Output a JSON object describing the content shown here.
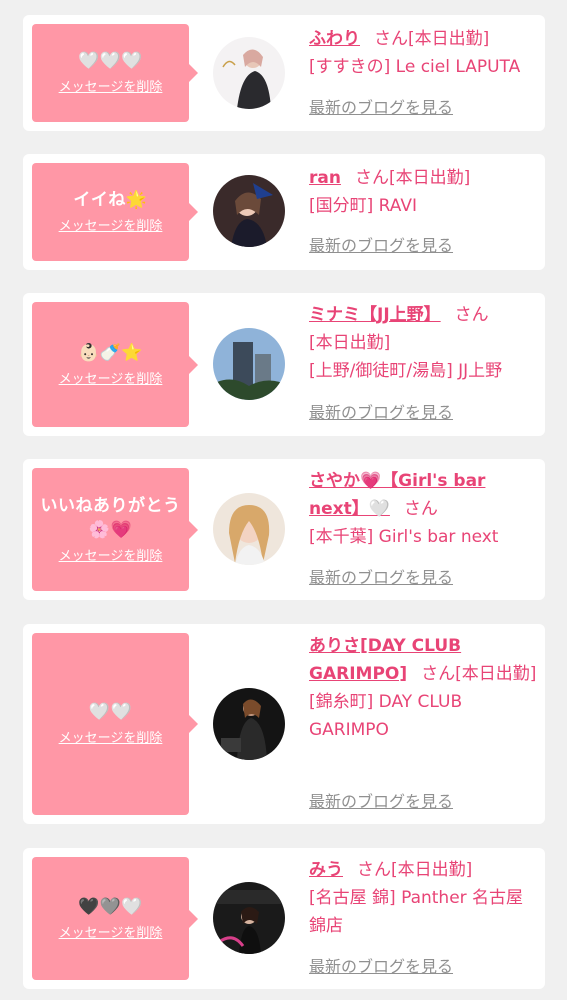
{
  "delete_label": "メッセージを削除",
  "blog_label": "最新のブログを見る",
  "san_label": "さん",
  "accent_color": "#ff97a6",
  "name_color": "#e84476",
  "items": [
    {
      "message": "🤍🤍🤍",
      "name": "ふわり",
      "status": "[本日出勤]",
      "area": "[すすきの]",
      "shop": "Le ciel LAPUTA",
      "avatar": "cast-photo-fuwari"
    },
    {
      "message": "イイね🌟",
      "name": "ran",
      "status": "[本日出勤]",
      "area": "[国分町]",
      "shop": "RAVI",
      "avatar": "cast-photo-ran"
    },
    {
      "message": "👶🏻🍼⭐️",
      "name": "ミナミ【JJ上野】",
      "status": "[本日出勤]",
      "area": "[上野/御徒町/湯島]",
      "shop": "JJ上野",
      "avatar": "cast-photo-minami"
    },
    {
      "message": "いいねありがとう🌸💗",
      "name": "さやか💗【Girl's bar next】🤍",
      "status": "",
      "area": "[本千葉]",
      "shop": "Girl's bar next",
      "avatar": "cast-photo-sayaka"
    },
    {
      "message": "🤍🤍",
      "name": "ありさ[DAY CLUB GARIMPO]",
      "status": "[本日出勤]",
      "area": "[錦糸町]",
      "shop": "DAY CLUB GARIMPO",
      "avatar": "cast-photo-arisa"
    },
    {
      "message": "🖤🩶🤍",
      "name": "みう",
      "status": "[本日出勤]",
      "area": "[名古屋 錦]",
      "shop": "Panther 名古屋錦店",
      "avatar": "cast-photo-miu"
    }
  ]
}
